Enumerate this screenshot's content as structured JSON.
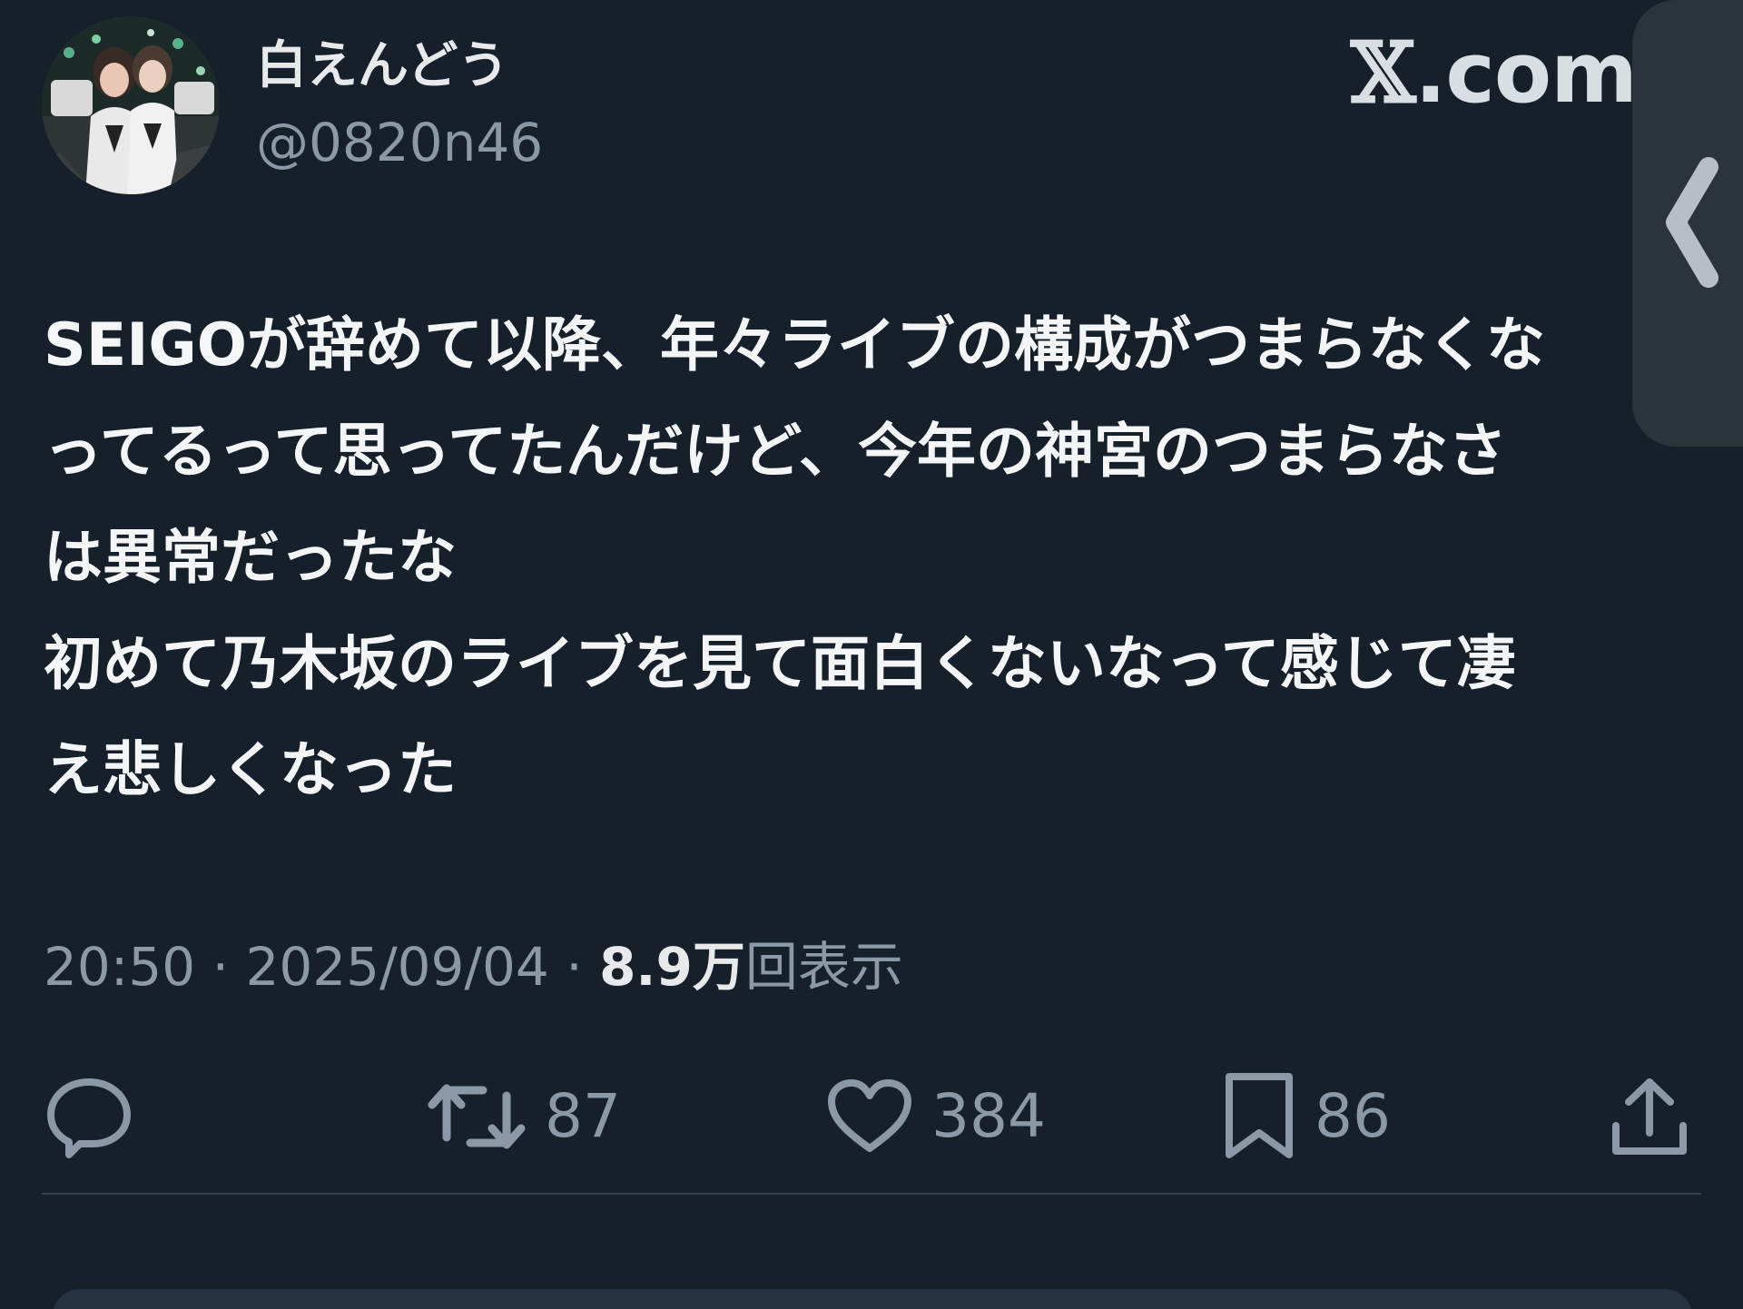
{
  "author": {
    "display_name": "白えんどう",
    "handle": "@0820n46",
    "avatar_icon": "profile-photo-icon"
  },
  "brand": {
    "x_glyph": "𝕏",
    "suffix": ".com"
  },
  "side_tab": {
    "icon": "chevron-left-icon"
  },
  "tweet": {
    "lines": [
      "SEIGOが辞めて以降、年々ライブの構成がつまらなくな",
      "ってるって思ってたんだけど、今年の神宮のつまらなさ",
      "は異常だったな",
      "初めて乃木坂のライブを見て面白くないなって感じて凄",
      "え悲しくなった"
    ]
  },
  "meta": {
    "time": "20:50",
    "separator": " · ",
    "date": "2025/09/04",
    "views_count": "8.9万",
    "views_label": "回表示"
  },
  "actions": {
    "reply": {
      "icon": "reply-icon",
      "count": ""
    },
    "retweet": {
      "icon": "retweet-icon",
      "count": "87"
    },
    "like": {
      "icon": "heart-icon",
      "count": "384"
    },
    "bookmark": {
      "icon": "bookmark-icon",
      "count": "86"
    },
    "share": {
      "icon": "share-icon"
    }
  },
  "colors": {
    "background": "#15202b",
    "text": "#e7e9ea",
    "secondary": "#8b98a5",
    "divider": "#38444d"
  }
}
